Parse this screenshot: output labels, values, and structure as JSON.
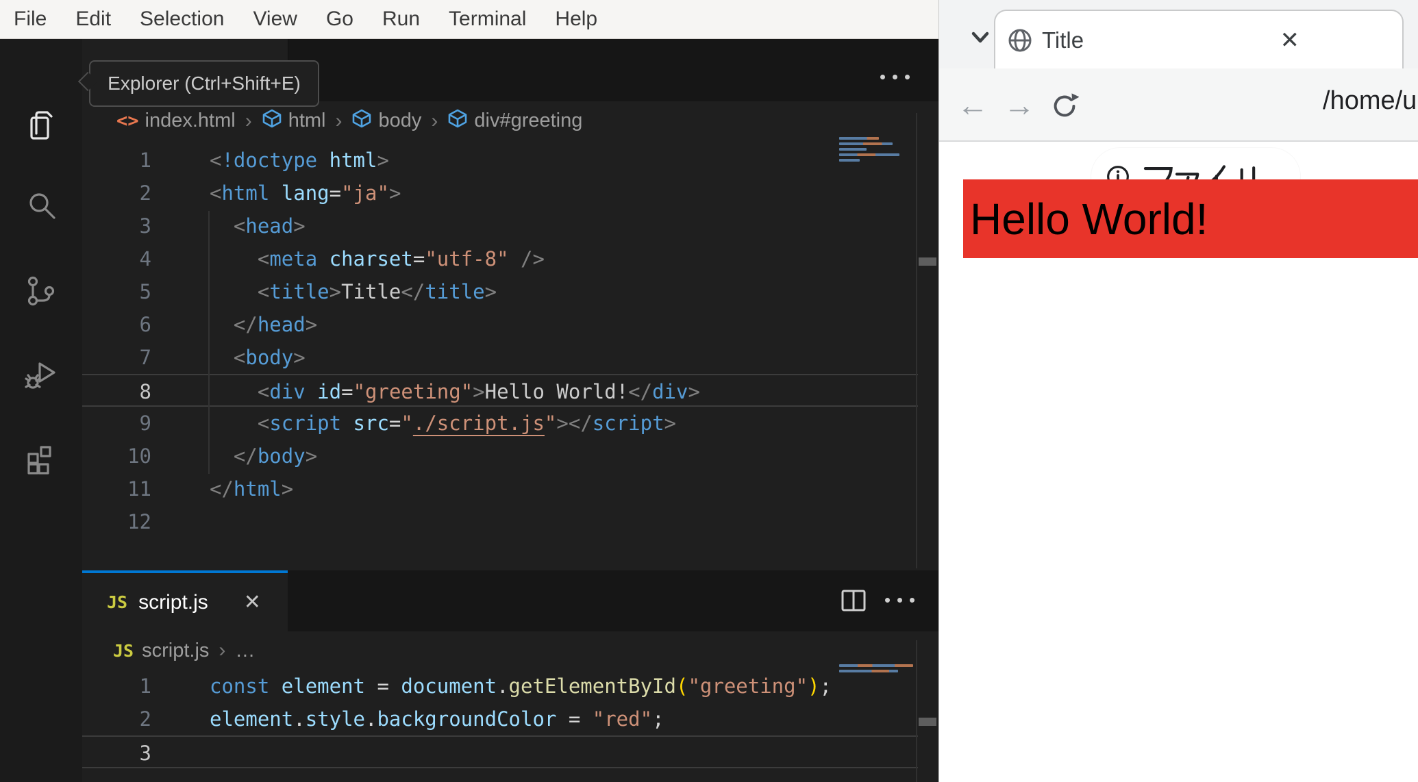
{
  "theme": {
    "accent_blue": "#0078d4",
    "page_red": "#e8342a",
    "editor_bg": "#1f1f1f"
  },
  "vscode": {
    "menu": {
      "items": [
        "File",
        "Edit",
        "Selection",
        "View",
        "Go",
        "Run",
        "Terminal",
        "Help"
      ]
    },
    "activity_bar": {
      "tooltip": "Explorer (Ctrl+Shift+E)",
      "items": [
        "explorer",
        "search",
        "source-control",
        "run-and-debug",
        "extensions"
      ]
    },
    "editor": {
      "breadcrumb": [
        {
          "icon": "htmlfile",
          "label": "index.html"
        },
        {
          "icon": "cube",
          "label": "html"
        },
        {
          "icon": "cube",
          "label": "body"
        },
        {
          "icon": "cube",
          "label": "div#greeting"
        }
      ],
      "active_line": 8,
      "lines": [
        [
          {
            "t": "<",
            "c": "punct"
          },
          {
            "t": "!doctype",
            "c": "tag"
          },
          {
            "t": " html",
            "c": "attr"
          },
          {
            "t": ">",
            "c": "punct"
          }
        ],
        [
          {
            "t": "<",
            "c": "punct"
          },
          {
            "t": "html",
            "c": "tag"
          },
          {
            "t": " lang",
            "c": "attr"
          },
          {
            "t": "=",
            "c": "op"
          },
          {
            "t": "\"ja\"",
            "c": "str"
          },
          {
            "t": ">",
            "c": "punct"
          }
        ],
        [
          {
            "t": "  ",
            "c": "ws"
          },
          {
            "t": "<",
            "c": "punct"
          },
          {
            "t": "head",
            "c": "tag"
          },
          {
            "t": ">",
            "c": "punct"
          }
        ],
        [
          {
            "t": "    ",
            "c": "ws"
          },
          {
            "t": "<",
            "c": "punct"
          },
          {
            "t": "meta",
            "c": "tag"
          },
          {
            "t": " charset",
            "c": "attr"
          },
          {
            "t": "=",
            "c": "op"
          },
          {
            "t": "\"utf-8\"",
            "c": "str"
          },
          {
            "t": " ",
            "c": "ws"
          },
          {
            "t": "/>",
            "c": "punct"
          }
        ],
        [
          {
            "t": "    ",
            "c": "ws"
          },
          {
            "t": "<",
            "c": "punct"
          },
          {
            "t": "title",
            "c": "tag"
          },
          {
            "t": ">",
            "c": "punct"
          },
          {
            "t": "Title",
            "c": "text"
          },
          {
            "t": "</",
            "c": "punct"
          },
          {
            "t": "title",
            "c": "tag"
          },
          {
            "t": ">",
            "c": "punct"
          }
        ],
        [
          {
            "t": "  ",
            "c": "ws"
          },
          {
            "t": "</",
            "c": "punct"
          },
          {
            "t": "head",
            "c": "tag"
          },
          {
            "t": ">",
            "c": "punct"
          }
        ],
        [
          {
            "t": "  ",
            "c": "ws"
          },
          {
            "t": "<",
            "c": "punct"
          },
          {
            "t": "body",
            "c": "tag"
          },
          {
            "t": ">",
            "c": "punct"
          }
        ],
        [
          {
            "t": "    ",
            "c": "ws"
          },
          {
            "t": "<",
            "c": "punct"
          },
          {
            "t": "div",
            "c": "tag"
          },
          {
            "t": " id",
            "c": "attr"
          },
          {
            "t": "=",
            "c": "op"
          },
          {
            "t": "\"greeting\"",
            "c": "str"
          },
          {
            "t": ">",
            "c": "punct"
          },
          {
            "t": "Hello World!",
            "c": "text"
          },
          {
            "t": "</",
            "c": "punct"
          },
          {
            "t": "div",
            "c": "tag"
          },
          {
            "t": ">",
            "c": "punct"
          }
        ],
        [
          {
            "t": "    ",
            "c": "ws"
          },
          {
            "t": "<",
            "c": "punct"
          },
          {
            "t": "script",
            "c": "tag"
          },
          {
            "t": " src",
            "c": "attr"
          },
          {
            "t": "=",
            "c": "op"
          },
          {
            "t": "\"",
            "c": "str"
          },
          {
            "t": "./script.js",
            "c": "link"
          },
          {
            "t": "\"",
            "c": "str"
          },
          {
            "t": ">",
            "c": "punct"
          },
          {
            "t": "</",
            "c": "punct"
          },
          {
            "t": "script",
            "c": "tag"
          },
          {
            "t": ">",
            "c": "punct"
          }
        ],
        [
          {
            "t": "  ",
            "c": "ws"
          },
          {
            "t": "</",
            "c": "punct"
          },
          {
            "t": "body",
            "c": "tag"
          },
          {
            "t": ">",
            "c": "punct"
          }
        ],
        [
          {
            "t": "</",
            "c": "punct"
          },
          {
            "t": "html",
            "c": "tag"
          },
          {
            "t": ">",
            "c": "punct"
          }
        ],
        []
      ]
    },
    "panel": {
      "tab": {
        "badge": "JS",
        "label": "script.js",
        "close": "✕"
      },
      "breadcrumb_file": "script.js",
      "breadcrumb_more": "…",
      "active_line": 3,
      "lines": [
        [
          {
            "t": "const",
            "c": "kw"
          },
          {
            "t": " ",
            "c": "ws"
          },
          {
            "t": "element",
            "c": "var"
          },
          {
            "t": " = ",
            "c": "op"
          },
          {
            "t": "document",
            "c": "var"
          },
          {
            "t": ".",
            "c": "op"
          },
          {
            "t": "getElementById",
            "c": "fn"
          },
          {
            "t": "(",
            "c": "brkt"
          },
          {
            "t": "\"greeting\"",
            "c": "str"
          },
          {
            "t": ")",
            "c": "brkt"
          },
          {
            "t": ";",
            "c": "op"
          }
        ],
        [
          {
            "t": "element",
            "c": "var"
          },
          {
            "t": ".",
            "c": "op"
          },
          {
            "t": "style",
            "c": "var"
          },
          {
            "t": ".",
            "c": "op"
          },
          {
            "t": "backgroundColor",
            "c": "var"
          },
          {
            "t": " = ",
            "c": "op"
          },
          {
            "t": "\"red\"",
            "c": "str"
          },
          {
            "t": ";",
            "c": "op"
          }
        ],
        []
      ]
    }
  },
  "browser": {
    "tab": {
      "title": "Title",
      "close": "✕"
    },
    "toolbar": {
      "back": "←",
      "forward": "→",
      "file_chip_label": "ファイル",
      "url": "/home/u"
    },
    "page": {
      "heading": "Hello World!"
    }
  }
}
